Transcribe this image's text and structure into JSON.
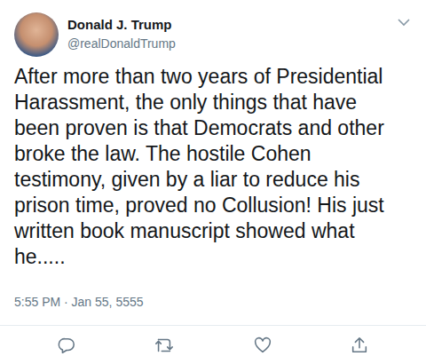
{
  "tweet": {
    "author": {
      "name": "Donald J. Trump",
      "handle": "@realDonaldTrump"
    },
    "text_lines": [
      "After more than two years of Presidential",
      "Harassment, the only things that have",
      "been proven is that Democrats and other",
      "broke the law. The hostile Cohen",
      "testimony, given by a liar to reduce his",
      "prison time, proved no Collusion! His just",
      "written book manuscript showed what",
      "he....."
    ],
    "timestamp": "5:55 PM · Jan 55, 5555"
  }
}
